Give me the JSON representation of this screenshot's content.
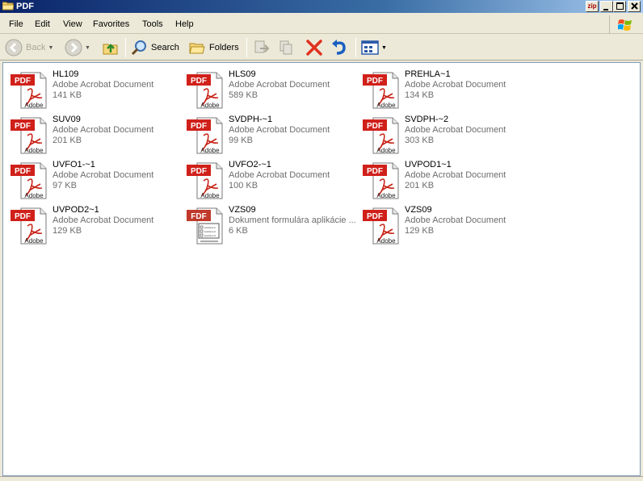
{
  "window": {
    "title": "PDF",
    "zip_label": "zip"
  },
  "menu": {
    "items": [
      "File",
      "Edit",
      "View",
      "Favorites",
      "Tools",
      "Help"
    ]
  },
  "toolbar": {
    "back_label": "Back",
    "search_label": "Search",
    "folders_label": "Folders"
  },
  "icons": {
    "pdf_badge": "PDF",
    "fdf_badge": "FDF",
    "adobe_text": "Adobe",
    "form_lines": [
      "List Item 1",
      "List Item 2",
      "List Item 3"
    ]
  },
  "files": [
    {
      "name": "HL109",
      "type": "Adobe Acrobat Document",
      "size": "141 KB",
      "kind": "pdf"
    },
    {
      "name": "HLS09",
      "type": "Adobe Acrobat Document",
      "size": "589 KB",
      "kind": "pdf"
    },
    {
      "name": "PREHLA~1",
      "type": "Adobe Acrobat Document",
      "size": "134 KB",
      "kind": "pdf"
    },
    {
      "name": "SUV09",
      "type": "Adobe Acrobat Document",
      "size": "201 KB",
      "kind": "pdf"
    },
    {
      "name": "SVDPH-~1",
      "type": "Adobe Acrobat Document",
      "size": "99 KB",
      "kind": "pdf"
    },
    {
      "name": "SVDPH-~2",
      "type": "Adobe Acrobat Document",
      "size": "303 KB",
      "kind": "pdf"
    },
    {
      "name": "UVFO1-~1",
      "type": "Adobe Acrobat Document",
      "size": "97 KB",
      "kind": "pdf"
    },
    {
      "name": "UVFO2-~1",
      "type": "Adobe Acrobat Document",
      "size": "100 KB",
      "kind": "pdf"
    },
    {
      "name": "UVPOD1~1",
      "type": "Adobe Acrobat Document",
      "size": "201 KB",
      "kind": "pdf"
    },
    {
      "name": "UVPOD2~1",
      "type": "Adobe Acrobat Document",
      "size": "129 KB",
      "kind": "pdf"
    },
    {
      "name": "VZS09",
      "type": "Dokument formulára aplikácie ...",
      "size": "6 KB",
      "kind": "fdf"
    },
    {
      "name": "VZS09",
      "type": "Adobe Acrobat Document",
      "size": "129 KB",
      "kind": "pdf"
    }
  ]
}
